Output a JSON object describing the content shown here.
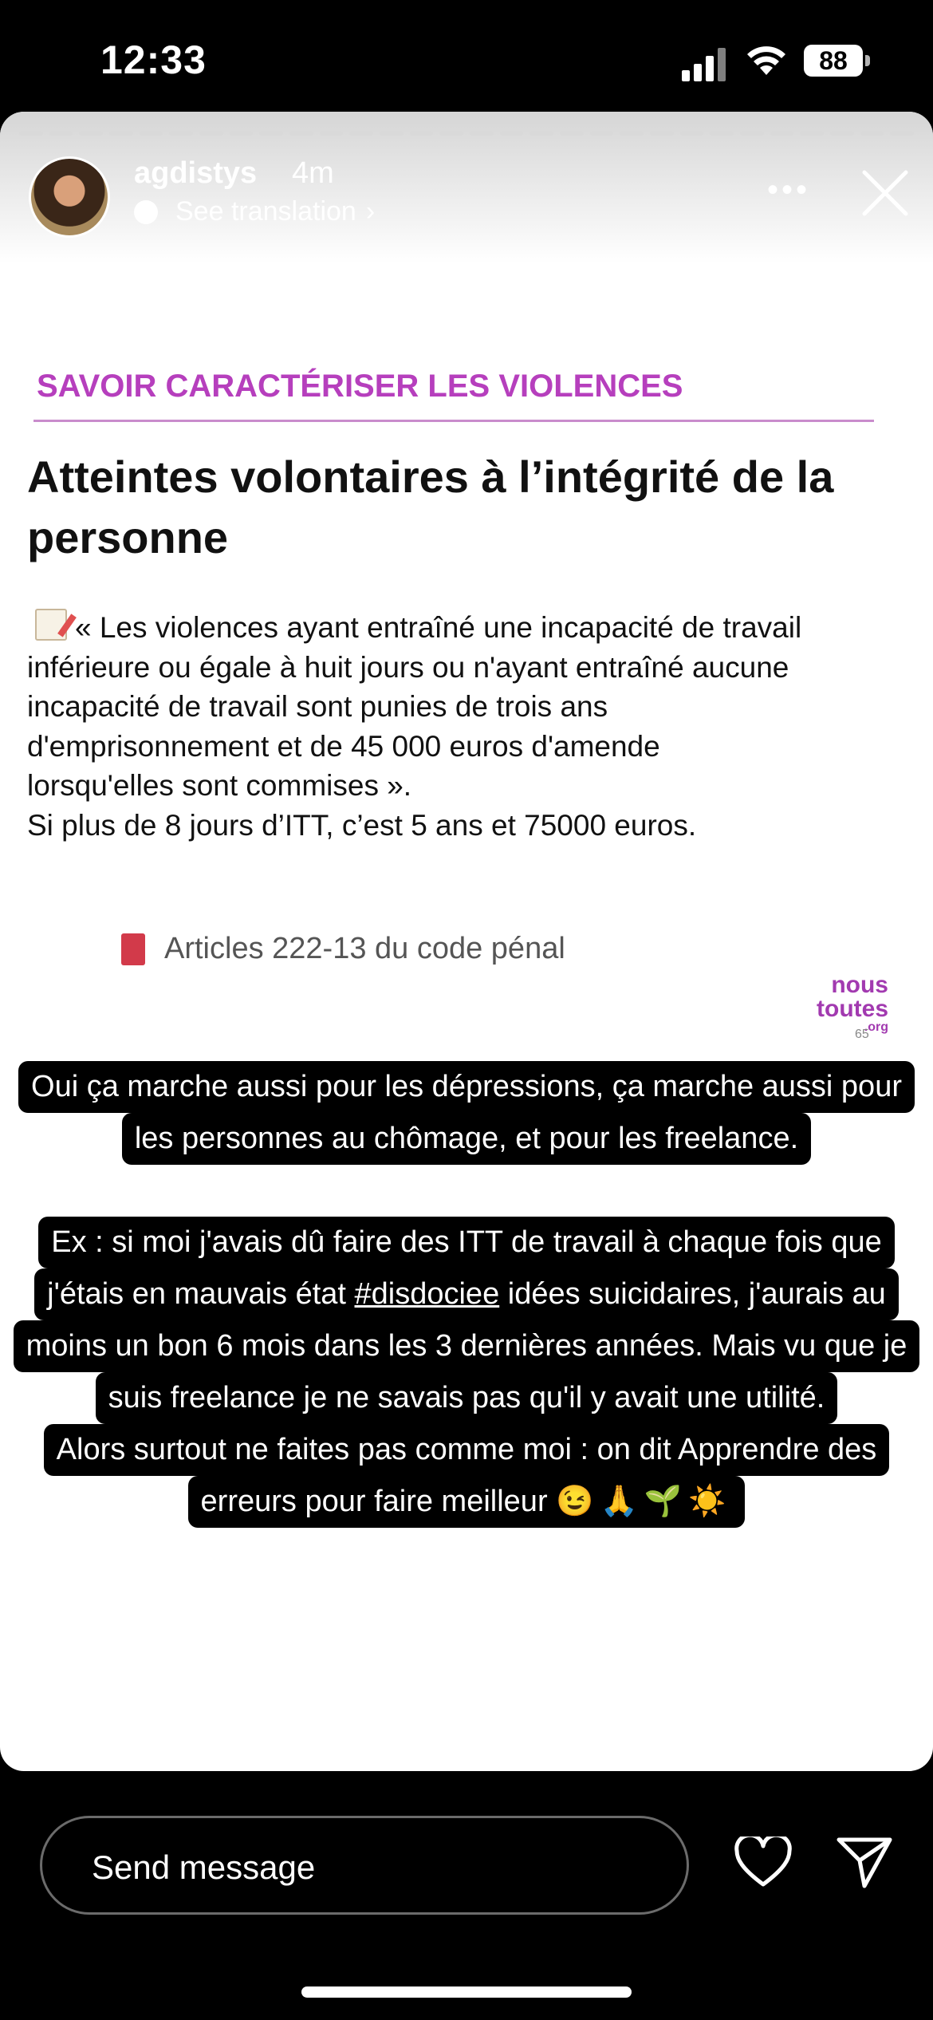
{
  "status_bar": {
    "time": "12:33",
    "battery": "88"
  },
  "story": {
    "username": "agdistys",
    "age": "4m",
    "translation": "See translation",
    "more": "•••"
  },
  "post": {
    "section": "SAVOIR CARACTÉRISER LES VIOLENCES",
    "title": "Atteintes volontaires à l’intégrité de la personne",
    "body_lines": [
      "« Les violences ayant entraîné une incapacité de travail",
      "inférieure ou égale à huit jours ou n'ayant entraîné aucune",
      "incapacité de travail sont punies de trois ans",
      "d'emprisonnement et de 45 000 euros d'amende",
      "lorsqu'elles sont commises ».",
      "Si plus de 8 jours d’ITT, c’est 5 ans et 75000 euros."
    ],
    "article": "Articles 222-13 du code pénal",
    "logo_line1": "nous",
    "logo_line2": "toutes",
    "logo_line3": ".org",
    "page_number": "65"
  },
  "caption": {
    "line1": "Oui ça marche aussi pour les dépressions, ça marche aussi pour",
    "line2": "les personnes au chômage, et pour les freelance.",
    "line3a": "Ex : si moi j'avais dû faire des ITT de travail à chaque fois que",
    "line4_pre": "j'étais en mauvais état ",
    "hashtag": "#disdociee",
    "line4_post": " idées suicidaires, j'aurais au",
    "line5": "moins un bon 6 mois dans les 3 dernières années. Mais vu que je",
    "line6": "suis freelance je ne savais pas qu'il y avait une utilité.",
    "line7": "Alors surtout ne faites pas comme moi : on dit Apprendre des",
    "line8": "erreurs pour faire meilleur",
    "emojis": "😉🙏🌱☀️"
  },
  "composer": {
    "placeholder": "Send message"
  },
  "icons": [
    "heart-icon",
    "send-icon",
    "close-icon",
    "globe-icon"
  ]
}
